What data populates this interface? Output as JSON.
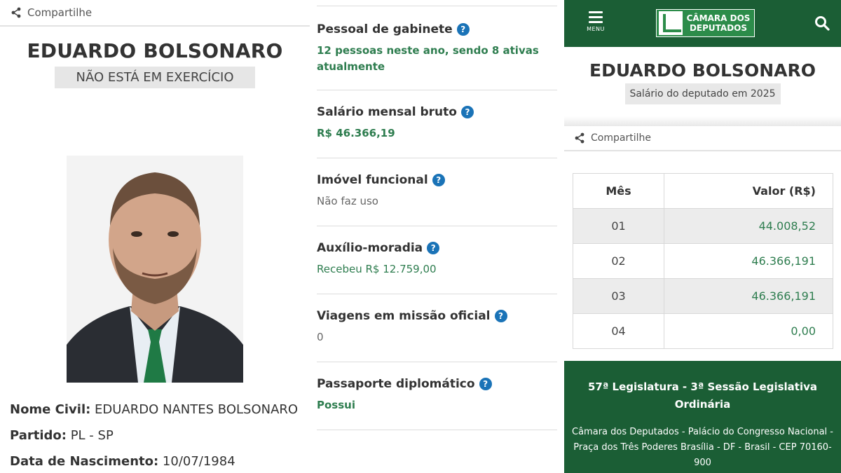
{
  "panel1": {
    "share_label": "Compartilhe",
    "name": "EDUARDO BOLSONARO",
    "status": "NÃO ESTÁ EM EXERCÍCIO",
    "info": [
      {
        "label": "Nome Civil:",
        "value": "EDUARDO NANTES BOLSONARO"
      },
      {
        "label": "Partido:",
        "value": "PL - SP"
      },
      {
        "label": "Data de Nascimento:",
        "value": "10/07/1984"
      }
    ]
  },
  "panel2": {
    "sections": [
      {
        "title": "Pessoal de gabinete",
        "value": "12 pessoas neste ano, sendo 8 ativas atualmente"
      },
      {
        "title": "Salário mensal bruto",
        "value": "R$ 46.366,19"
      },
      {
        "title": "Imóvel funcional",
        "value": "Não faz uso"
      },
      {
        "title": "Auxílio-moradia",
        "value": "Recebeu R$ 12.759,00"
      },
      {
        "title": "Viagens em missão oficial",
        "value": "0"
      },
      {
        "title": "Passaporte diplomático",
        "value": "Possui"
      }
    ],
    "help_glyph": "?"
  },
  "panel3": {
    "menu_label": "MENU",
    "logo_line1": "CÂMARA DOS",
    "logo_line2": "DEPUTADOS",
    "name": "EDUARDO BOLSONARO",
    "subtitle": "Salário do deputado em 2025",
    "share_label": "Compartilhe",
    "table": {
      "headers": [
        "Mês",
        "Valor (R$)"
      ],
      "rows": [
        [
          "01",
          "44.008,52"
        ],
        [
          "02",
          "46.366,191"
        ],
        [
          "03",
          "46.366,191"
        ],
        [
          "04",
          "0,00"
        ]
      ]
    },
    "footer": {
      "legislature": "57ª Legislatura - 3ª Sessão Legislativa Ordinária",
      "address": "Câmara dos Deputados - Palácio do Congresso Nacional - Praça dos Três Poderes Brasília - DF - Brasil - CEP 70160-900"
    }
  },
  "colors": {
    "brand_green": "#1b5e35",
    "text_green": "#2e7d4f",
    "help_blue": "#1a73b7"
  },
  "icons": [
    "share-icon",
    "help-icon",
    "menu-icon",
    "search-icon",
    "camara-logo"
  ]
}
